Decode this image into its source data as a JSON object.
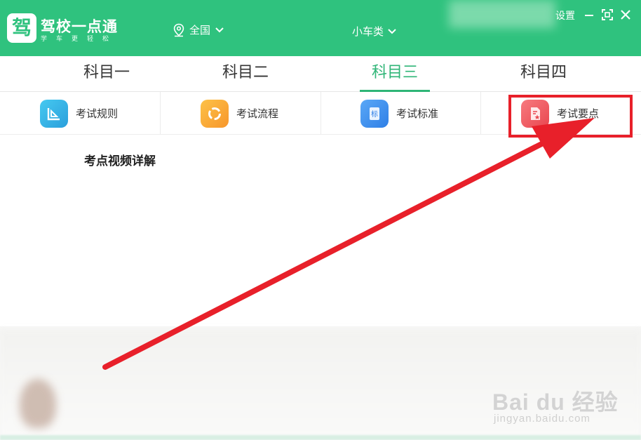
{
  "header": {
    "logo_glyph": "驾",
    "brand_name": "驾校一点通",
    "slogan": "学车更轻松",
    "region": "全国",
    "car_type": "小车类",
    "settings_label": "设置",
    "colors": {
      "brand_green": "#2fc27e"
    }
  },
  "tabs": [
    {
      "label": "科目一",
      "active": false
    },
    {
      "label": "科目二",
      "active": false
    },
    {
      "label": "科目三",
      "active": true
    },
    {
      "label": "科目四",
      "active": false
    }
  ],
  "features": [
    {
      "label": "考试规则",
      "icon": "ruler-icon",
      "glyph": "N",
      "color": "#35b8e6"
    },
    {
      "label": "考试流程",
      "icon": "cycle-icon",
      "glyph": "◔",
      "color": "#f8a531"
    },
    {
      "label": "考试标准",
      "icon": "book-icon",
      "glyph": "标",
      "color": "#3b8af0"
    },
    {
      "label": "考试要点",
      "icon": "document-star-icon",
      "glyph": "▤",
      "color": "#ef5a63"
    }
  ],
  "section": {
    "title": "考点视频详解"
  },
  "watermark": {
    "text": "Bai du 经验",
    "sub": "jingyan.baidu.com"
  },
  "annotation": {
    "color": "#e8202a",
    "target": "考试要点"
  }
}
